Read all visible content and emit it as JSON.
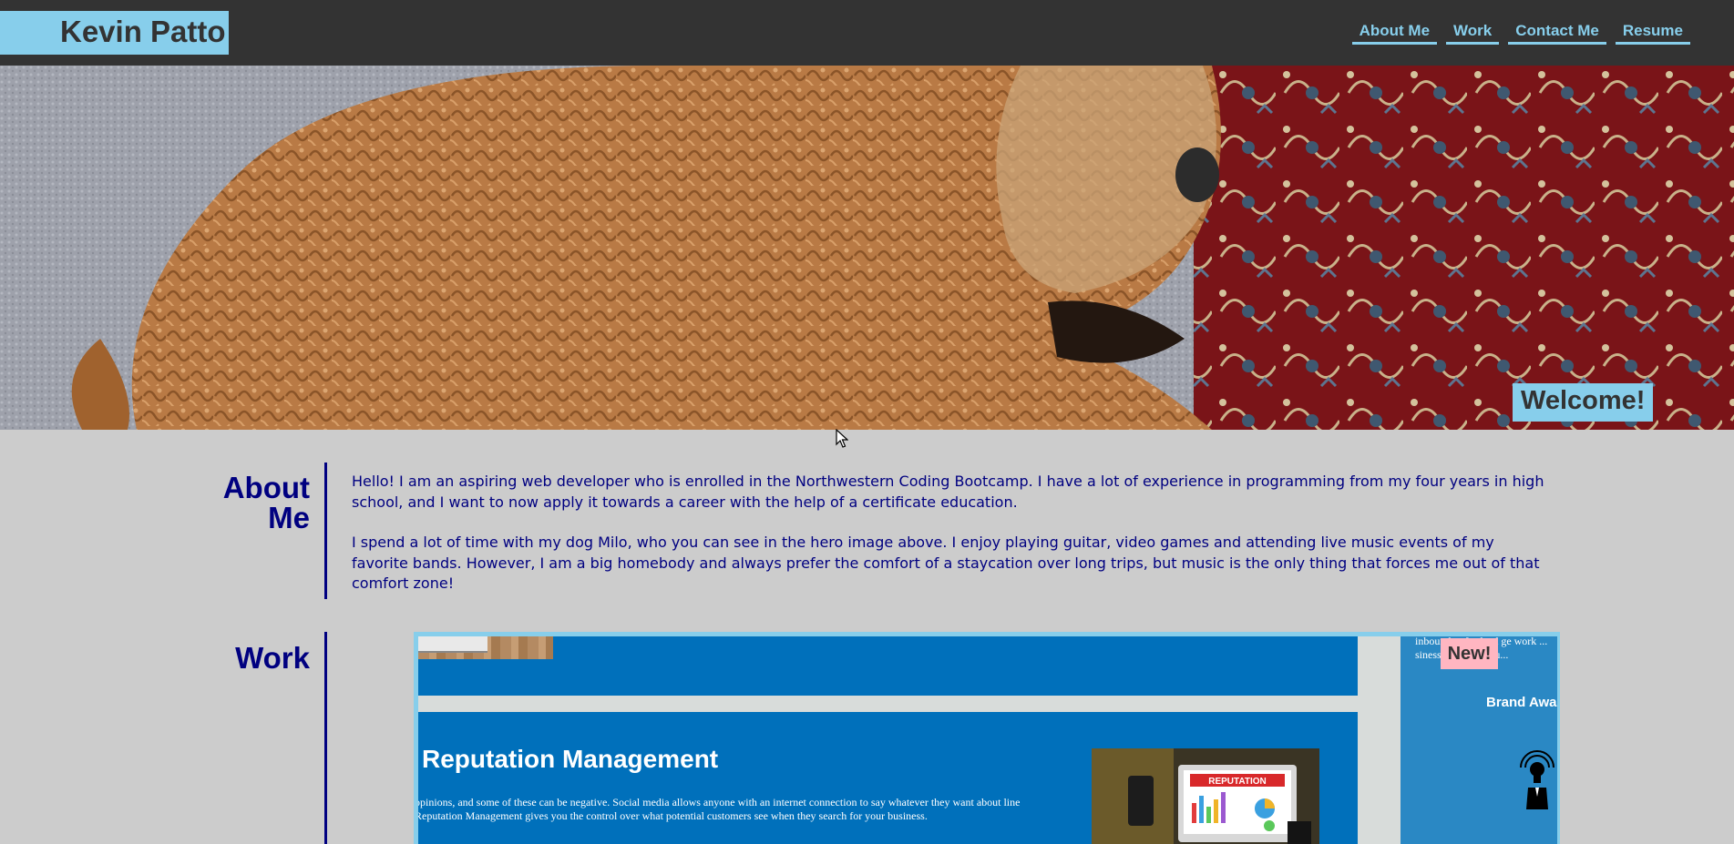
{
  "header": {
    "logo": "Kevin Patto",
    "nav": [
      "About Me",
      "Work",
      "Contact Me",
      "Resume"
    ]
  },
  "hero": {
    "welcome": "Welcome!"
  },
  "about": {
    "title": "About Me",
    "paragraphs": [
      "Hello! I am an aspiring web developer who is enrolled in the Northwestern Coding Bootcamp. I have a lot of experience in programming from my four years in high school, and I want to now apply it towards a career with the help of a certificate education.",
      "I spend a lot of time with my dog Milo, who you can see in the hero image above. I enjoy playing guitar, video games and attending live music events of my favorite bands. However, I am a big homebody and always prefer the comfort of a staycation over long trips, but music is the only thing that forces me out of that comfort zone!"
    ]
  },
  "work": {
    "title": "Work",
    "badge": "New!",
    "slide": {
      "heading": "Reputation Management",
      "body": "opinions, and some of these can be negative. Social media allows anyone with an internet connection to say whatever they want about line Reputation Management gives you the control over what potential customers see when they search for your business.",
      "image_label": "REPUTATION"
    },
    "side": {
      "text": "inbound ... for lead ge work ... siness, bring to you...",
      "heading": "Brand Awa"
    }
  },
  "colors": {
    "header_bg": "#333333",
    "accent": "#87ceeb",
    "body_bg": "#cccccc",
    "heading": "#000080",
    "badge": "#ffb6c1",
    "slide_bg": "#0070bb"
  }
}
